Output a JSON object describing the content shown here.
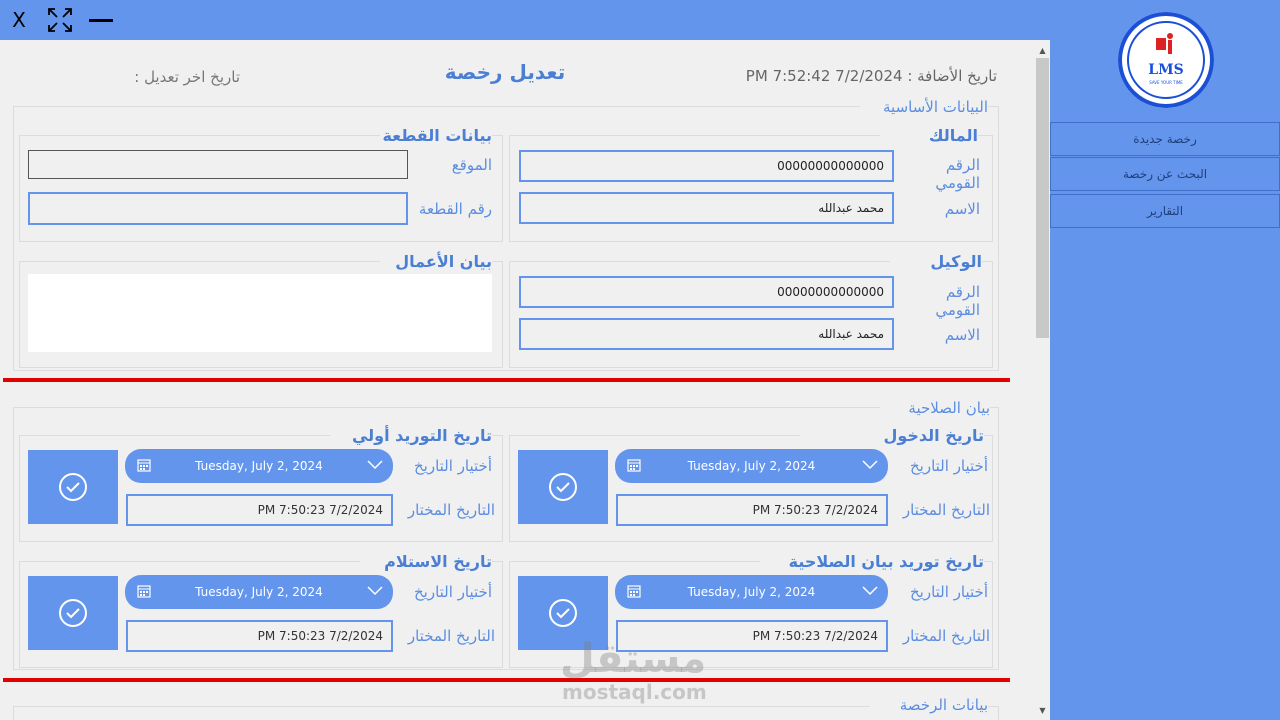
{
  "titlebar": {
    "close": "X"
  },
  "sidebar": {
    "logo_text": "LMS",
    "logo_sub": "SAVE YOUR TIME",
    "items": [
      {
        "label": "رخصة جديدة"
      },
      {
        "label": "البحث عن رخصة"
      },
      {
        "label": "التقارير"
      }
    ]
  },
  "header": {
    "title": "تعديل رخصة",
    "added_date": "PM تاريخ الأضافة : 7/2/2024 7:52:42",
    "last_modified": "تاريخ اخر تعديل :"
  },
  "basic": {
    "title": "البيانات الأساسية",
    "owner": {
      "title": "المالك",
      "national_id_label": "الرقم القومي",
      "national_id": "00000000000000",
      "name_label": "الاسم",
      "name": "محمد عبدالله"
    },
    "plot": {
      "title": "بيانات القطعة",
      "location_label": "الموقع",
      "location": "",
      "number_label": "رقم القطعة",
      "number": ""
    },
    "agent": {
      "title": "الوكيل",
      "national_id_label": "الرقم القومي",
      "national_id": "00000000000000",
      "name_label": "الاسم",
      "name": "محمد عبدالله"
    },
    "works": {
      "title": "بيان الأعمال",
      "value": ""
    }
  },
  "validity": {
    "title": "بيان الصلاحية",
    "pick_label": "أختيار التاريخ",
    "selected_label": "التاريخ المختار",
    "blocks": [
      {
        "title": "تاريخ الدخول",
        "picker": "Tuesday, July 2, 2024",
        "selected": "PM 7:50:23 7/2/2024"
      },
      {
        "title": "تاريخ التوريد أولي",
        "picker": "Tuesday, July 2, 2024",
        "selected": "PM 7:50:23 7/2/2024"
      },
      {
        "title": "تاريخ توريد بيان الصلاحية",
        "picker": "Tuesday, July 2, 2024",
        "selected": "PM 7:50:23 7/2/2024"
      },
      {
        "title": "تاريخ الاستلام",
        "picker": "Tuesday, July 2, 2024",
        "selected": "PM 7:50:23 7/2/2024"
      }
    ]
  },
  "license": {
    "title": "بيانات الرخصة"
  },
  "watermark": {
    "arabic": "مستقل",
    "latin": "mostaql.com"
  },
  "colors": {
    "accent": "#6495ed",
    "heading": "#4a7fd4",
    "divider": "#e00000"
  }
}
